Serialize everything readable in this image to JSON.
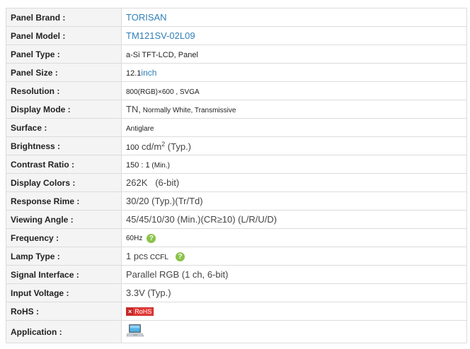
{
  "specs": {
    "brand": {
      "label": "Panel Brand :",
      "value": "TORISAN"
    },
    "model": {
      "label": "Panel Model :",
      "value": "TM121SV-02L09"
    },
    "type": {
      "label": "Panel Type :",
      "value": "a-Si TFT-LCD, Panel"
    },
    "size": {
      "label": "Panel Size :",
      "number": "12.1",
      "unit": "inch"
    },
    "resolution": {
      "label": "Resolution :",
      "value": "800(RGB)×600 , SVGA"
    },
    "display_mode": {
      "label": "Display Mode :",
      "main": "TN,",
      "detail": " Normally White, Transmissive"
    },
    "surface": {
      "label": "Surface :",
      "value": "Antiglare"
    },
    "brightness": {
      "label": "Brightness :",
      "number": "100",
      "unit": " cd/m",
      "exponent": "2",
      "suffix": " (Typ.)"
    },
    "contrast": {
      "label": "Contrast Ratio :",
      "number": "150 : 1",
      "suffix": " (Min.)"
    },
    "colors": {
      "label": "Display Colors :",
      "value": "262K   (6-bit)"
    },
    "response": {
      "label": "Response Rime :",
      "value": "30/20 (Typ.)(Tr/Td)"
    },
    "viewing_angle": {
      "label": "Viewing Angle :",
      "value": "45/45/10/30 (Min.)(CR≥10) (L/R/U/D)"
    },
    "frequency": {
      "label": "Frequency :",
      "value": "60Hz"
    },
    "lamp": {
      "label": "Lamp Type :",
      "number": "1 pcs",
      "detail": " CCFL"
    },
    "signal": {
      "label": "Signal Interface :",
      "value": "Parallel RGB (1 ch, 6-bit)"
    },
    "voltage": {
      "label": "Input Voltage :",
      "value": "3.3V (Typ.)"
    },
    "rohs": {
      "label": "RoHS :",
      "badge_mark": "×",
      "badge_text": "RoHS"
    },
    "application": {
      "label": "Application :"
    }
  },
  "icons": {
    "help": "?",
    "help_color": "#8bc34a",
    "rohs_color": "#c62828",
    "application": "laptop-icon"
  }
}
